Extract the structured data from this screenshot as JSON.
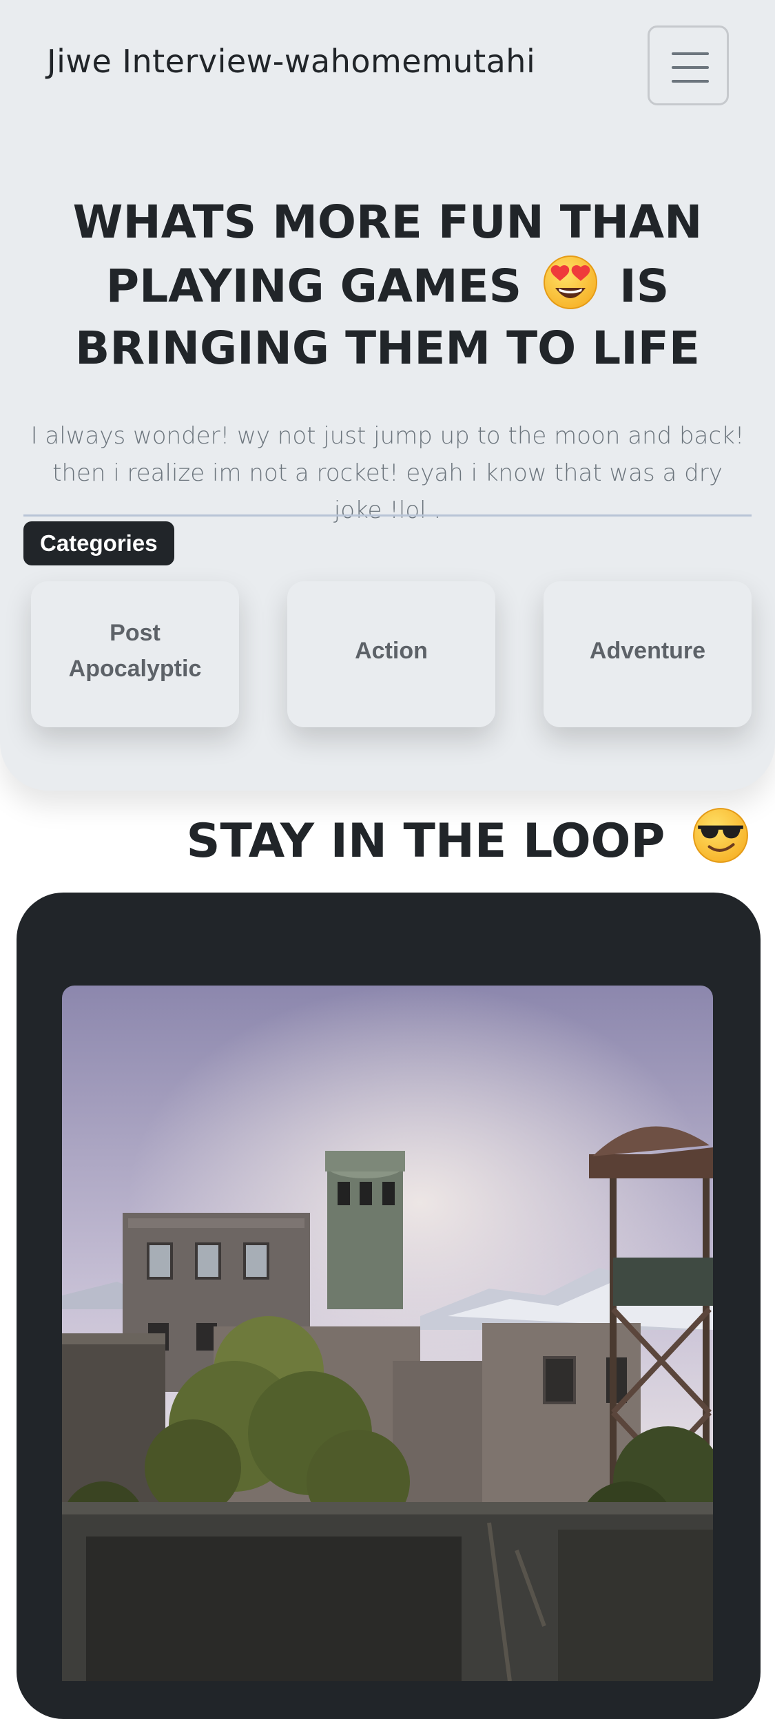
{
  "navbar": {
    "brand": "Jiwe Interview-wahomemutahi",
    "toggler_icon": "hamburger-menu-icon"
  },
  "hero": {
    "headline_part1": "WHATS MORE FUN THAN PLAYING GAMES",
    "headline_emoji": "heart-eyes-emoji",
    "headline_part2": "IS BRINGING THEM TO LIFE",
    "lead": "I always wonder! wy not just jump up to the moon and back! then i realize im not a rocket! eyah i know that was a dry joke !lol ."
  },
  "categories": {
    "badge": "Categories",
    "items": [
      {
        "label": "Post Apocalyptic"
      },
      {
        "label": "Action"
      },
      {
        "label": "Adventure"
      }
    ]
  },
  "loop": {
    "title": "STAY IN THE LOOP",
    "emoji": "sunglasses-emoji"
  },
  "feature": {
    "image_subject": "post-apocalyptic-compound-image"
  },
  "colors": {
    "page_background": "#ffffff",
    "hero_background": "#e9ecef",
    "dark": "#212529",
    "muted_text": "#6c757d",
    "divider": "#b8c4d6"
  }
}
